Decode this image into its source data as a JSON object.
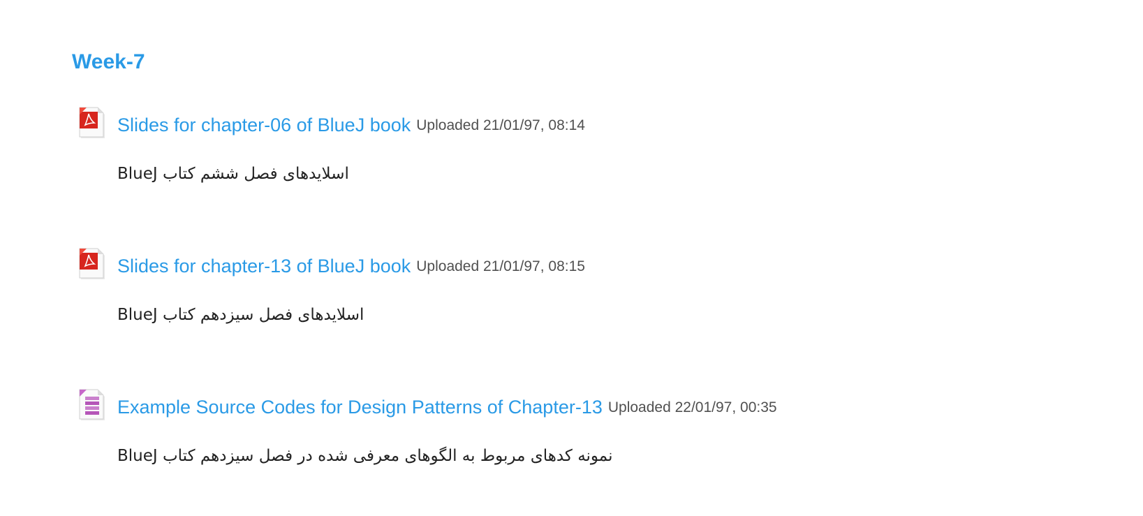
{
  "section": {
    "title": "Week-7"
  },
  "activities": [
    {
      "icon": "pdf-icon",
      "title": "Slides for chapter-06 of BlueJ book",
      "upload_info": "Uploaded 21/01/97, 08:14",
      "description": "اسلایدهای فصل ششم کتاب BlueJ"
    },
    {
      "icon": "pdf-icon",
      "title": "Slides for chapter-13 of BlueJ book",
      "upload_info": "Uploaded 21/01/97, 08:15",
      "description": "اسلایدهای فصل سیزدهم کتاب BlueJ"
    },
    {
      "icon": "archive-icon",
      "title": "Example Source Codes for Design Patterns of Chapter-13",
      "upload_info": "Uploaded 22/01/97, 00:35",
      "description": "نمونه کدهای مربوط به الگوهای معرفی شده در فصل سیزدهم کتاب BlueJ"
    }
  ],
  "colors": {
    "link": "#2a9ae6",
    "meta_text": "#505050",
    "body_text": "#222222",
    "pdf_red": "#d7261e",
    "archive_purple": "#b556b8"
  }
}
